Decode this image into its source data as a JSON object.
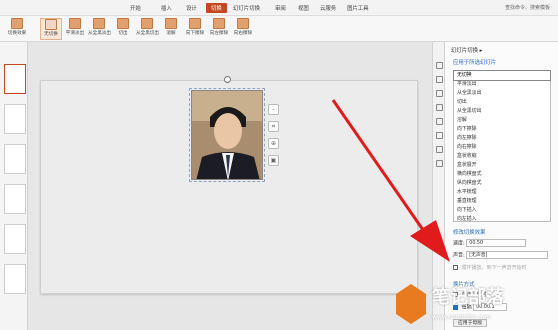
{
  "menubar": {
    "tabs": [
      "开始",
      "插入",
      "设计",
      "切换",
      "幻灯片切换",
      "审阅",
      "视图",
      "云服务",
      "图片工具"
    ],
    "active": 3,
    "search": "查找命令、搜索模板"
  },
  "ribbon": {
    "items": [
      "切换效果",
      "无切换",
      "平滑淡出",
      "从全黑淡出",
      "切出",
      "从全黑切出",
      "溶解",
      "向下擦除",
      "向左擦除",
      "向右擦除"
    ],
    "selected_index": 1
  },
  "canvas": {
    "photo_caption": "",
    "tools": [
      "crop-icon",
      "zoom-icon",
      "image-icon"
    ]
  },
  "panel": {
    "title": "幻灯片切换 ▸",
    "apply_section": "应用于所选幻灯片",
    "effects": [
      "无切换",
      "平滑淡出",
      "从全黑淡出",
      "切出",
      "从全黑切出",
      "溶解",
      "向下擦除",
      "向左擦除",
      "向右擦除",
      "盒状收缩",
      "盒状展开",
      "横向棋盘式",
      "纵向棋盘式",
      "水平梳理",
      "垂直梳理",
      "向下插入",
      "向左插入"
    ],
    "selected_effect": 0,
    "modify_section": "修改切换效果",
    "speed_label": "速度:",
    "speed_value": "00.50",
    "sound_label": "声音:",
    "sound_value": "[无声音]",
    "loop_label": "循环播放，到下一声音开始时",
    "advance_section": "换片方式",
    "on_click_label": "单击鼠标时",
    "auto_label": "每隔",
    "auto_value": "00:00.1",
    "apply_button": "应用于母版"
  },
  "watermark": {
    "cn": "笔记部落",
    "url": "www.notetribe.com"
  },
  "colors": {
    "accent": "#c6481f",
    "link": "#2a6cc4",
    "arrow": "#e11b1b"
  }
}
